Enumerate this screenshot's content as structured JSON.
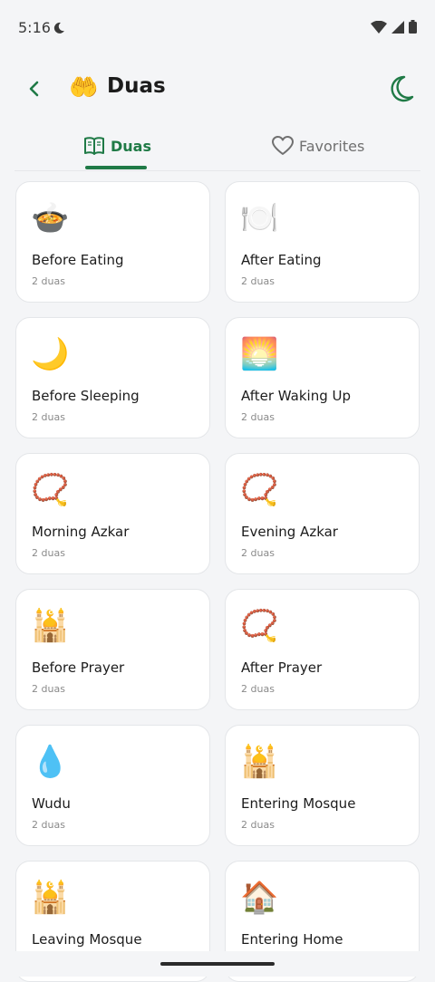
{
  "status": {
    "time": "5:16"
  },
  "header": {
    "title": "Duas",
    "emoji": "🤲"
  },
  "tabs": [
    {
      "label": "Duas",
      "icon": "book-open-icon",
      "selected": true
    },
    {
      "label": "Favorites",
      "icon": "heart-icon",
      "selected": false
    }
  ],
  "categories": [
    {
      "title": "Before Eating",
      "count": "2 duas",
      "icon": "🍲"
    },
    {
      "title": "After Eating",
      "count": "2 duas",
      "icon": "🍽️"
    },
    {
      "title": "Before Sleeping",
      "count": "2 duas",
      "icon": "🌙"
    },
    {
      "title": "After Waking Up",
      "count": "2 duas",
      "icon": "🌅"
    },
    {
      "title": "Morning Azkar",
      "count": "2 duas",
      "icon": "📿"
    },
    {
      "title": "Evening Azkar",
      "count": "2 duas",
      "icon": "📿"
    },
    {
      "title": "Before Prayer",
      "count": "2 duas",
      "icon": "🕌"
    },
    {
      "title": "After Prayer",
      "count": "2 duas",
      "icon": "📿"
    },
    {
      "title": "Wudu",
      "count": "2 duas",
      "icon": "💧"
    },
    {
      "title": "Entering Mosque",
      "count": "2 duas",
      "icon": "🕌"
    },
    {
      "title": "Leaving Mosque",
      "count": "",
      "icon": "🕌"
    },
    {
      "title": "Entering Home",
      "count": "",
      "icon": "🏠"
    }
  ],
  "colors": {
    "accent": "#1f7a46",
    "background": "#f4f5f7",
    "card": "#ffffff"
  }
}
